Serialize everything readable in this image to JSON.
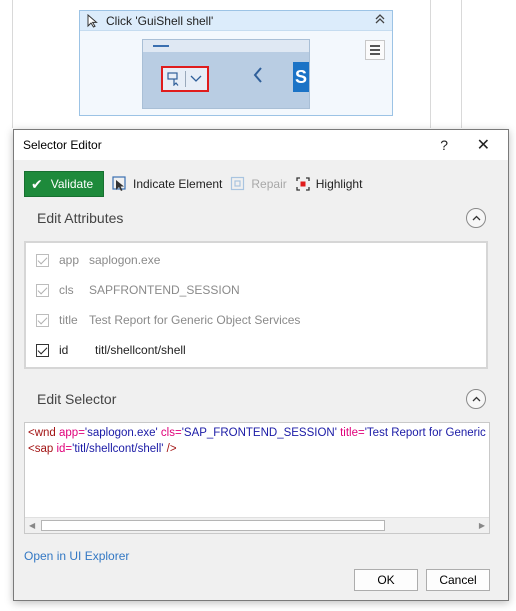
{
  "activity": {
    "title": "Click 'GuiShell  shell'",
    "collapse_glyph": "⌃"
  },
  "dialog": {
    "title": "Selector Editor",
    "help_label": "?",
    "close_label": "✕"
  },
  "toolbar": {
    "validate_label": "Validate",
    "indicate_label": "Indicate Element",
    "repair_label": "Repair",
    "highlight_label": "Highlight"
  },
  "edit_attributes": {
    "title": "Edit Attributes",
    "rows": [
      {
        "name": "app",
        "value": "saplogon.exe",
        "checked": true,
        "enabled": false
      },
      {
        "name": "cls",
        "value": "SAPFRONTEND_SESSION",
        "checked": true,
        "enabled": false
      },
      {
        "name": "title",
        "value": "Test Report for Generic Object Services",
        "checked": true,
        "enabled": false
      },
      {
        "name": "id",
        "value": "titl/shellcont/shell",
        "checked": true,
        "enabled": true
      }
    ]
  },
  "edit_selector": {
    "title": "Edit Selector",
    "line1": {
      "tag_open": "<wnd ",
      "a1": "app=",
      "v1": "'saplogon.exe'",
      "a2": " cls=",
      "v2": "'SAP_FRONTEND_SESSION'",
      "a3": " title=",
      "v3": "'Test Report for Generic"
    },
    "line2": {
      "tag_open": "<sap ",
      "a1": "id=",
      "v1": "'titl/shellcont/shell'",
      "tag_close": " />"
    }
  },
  "footer": {
    "open_ui_explorer": "Open in UI Explorer",
    "ok_label": "OK",
    "cancel_label": "Cancel"
  },
  "colors": {
    "validate_green": "#1e8a3b",
    "link_blue": "#3378c4",
    "highlight_red": "#e01c1c"
  }
}
